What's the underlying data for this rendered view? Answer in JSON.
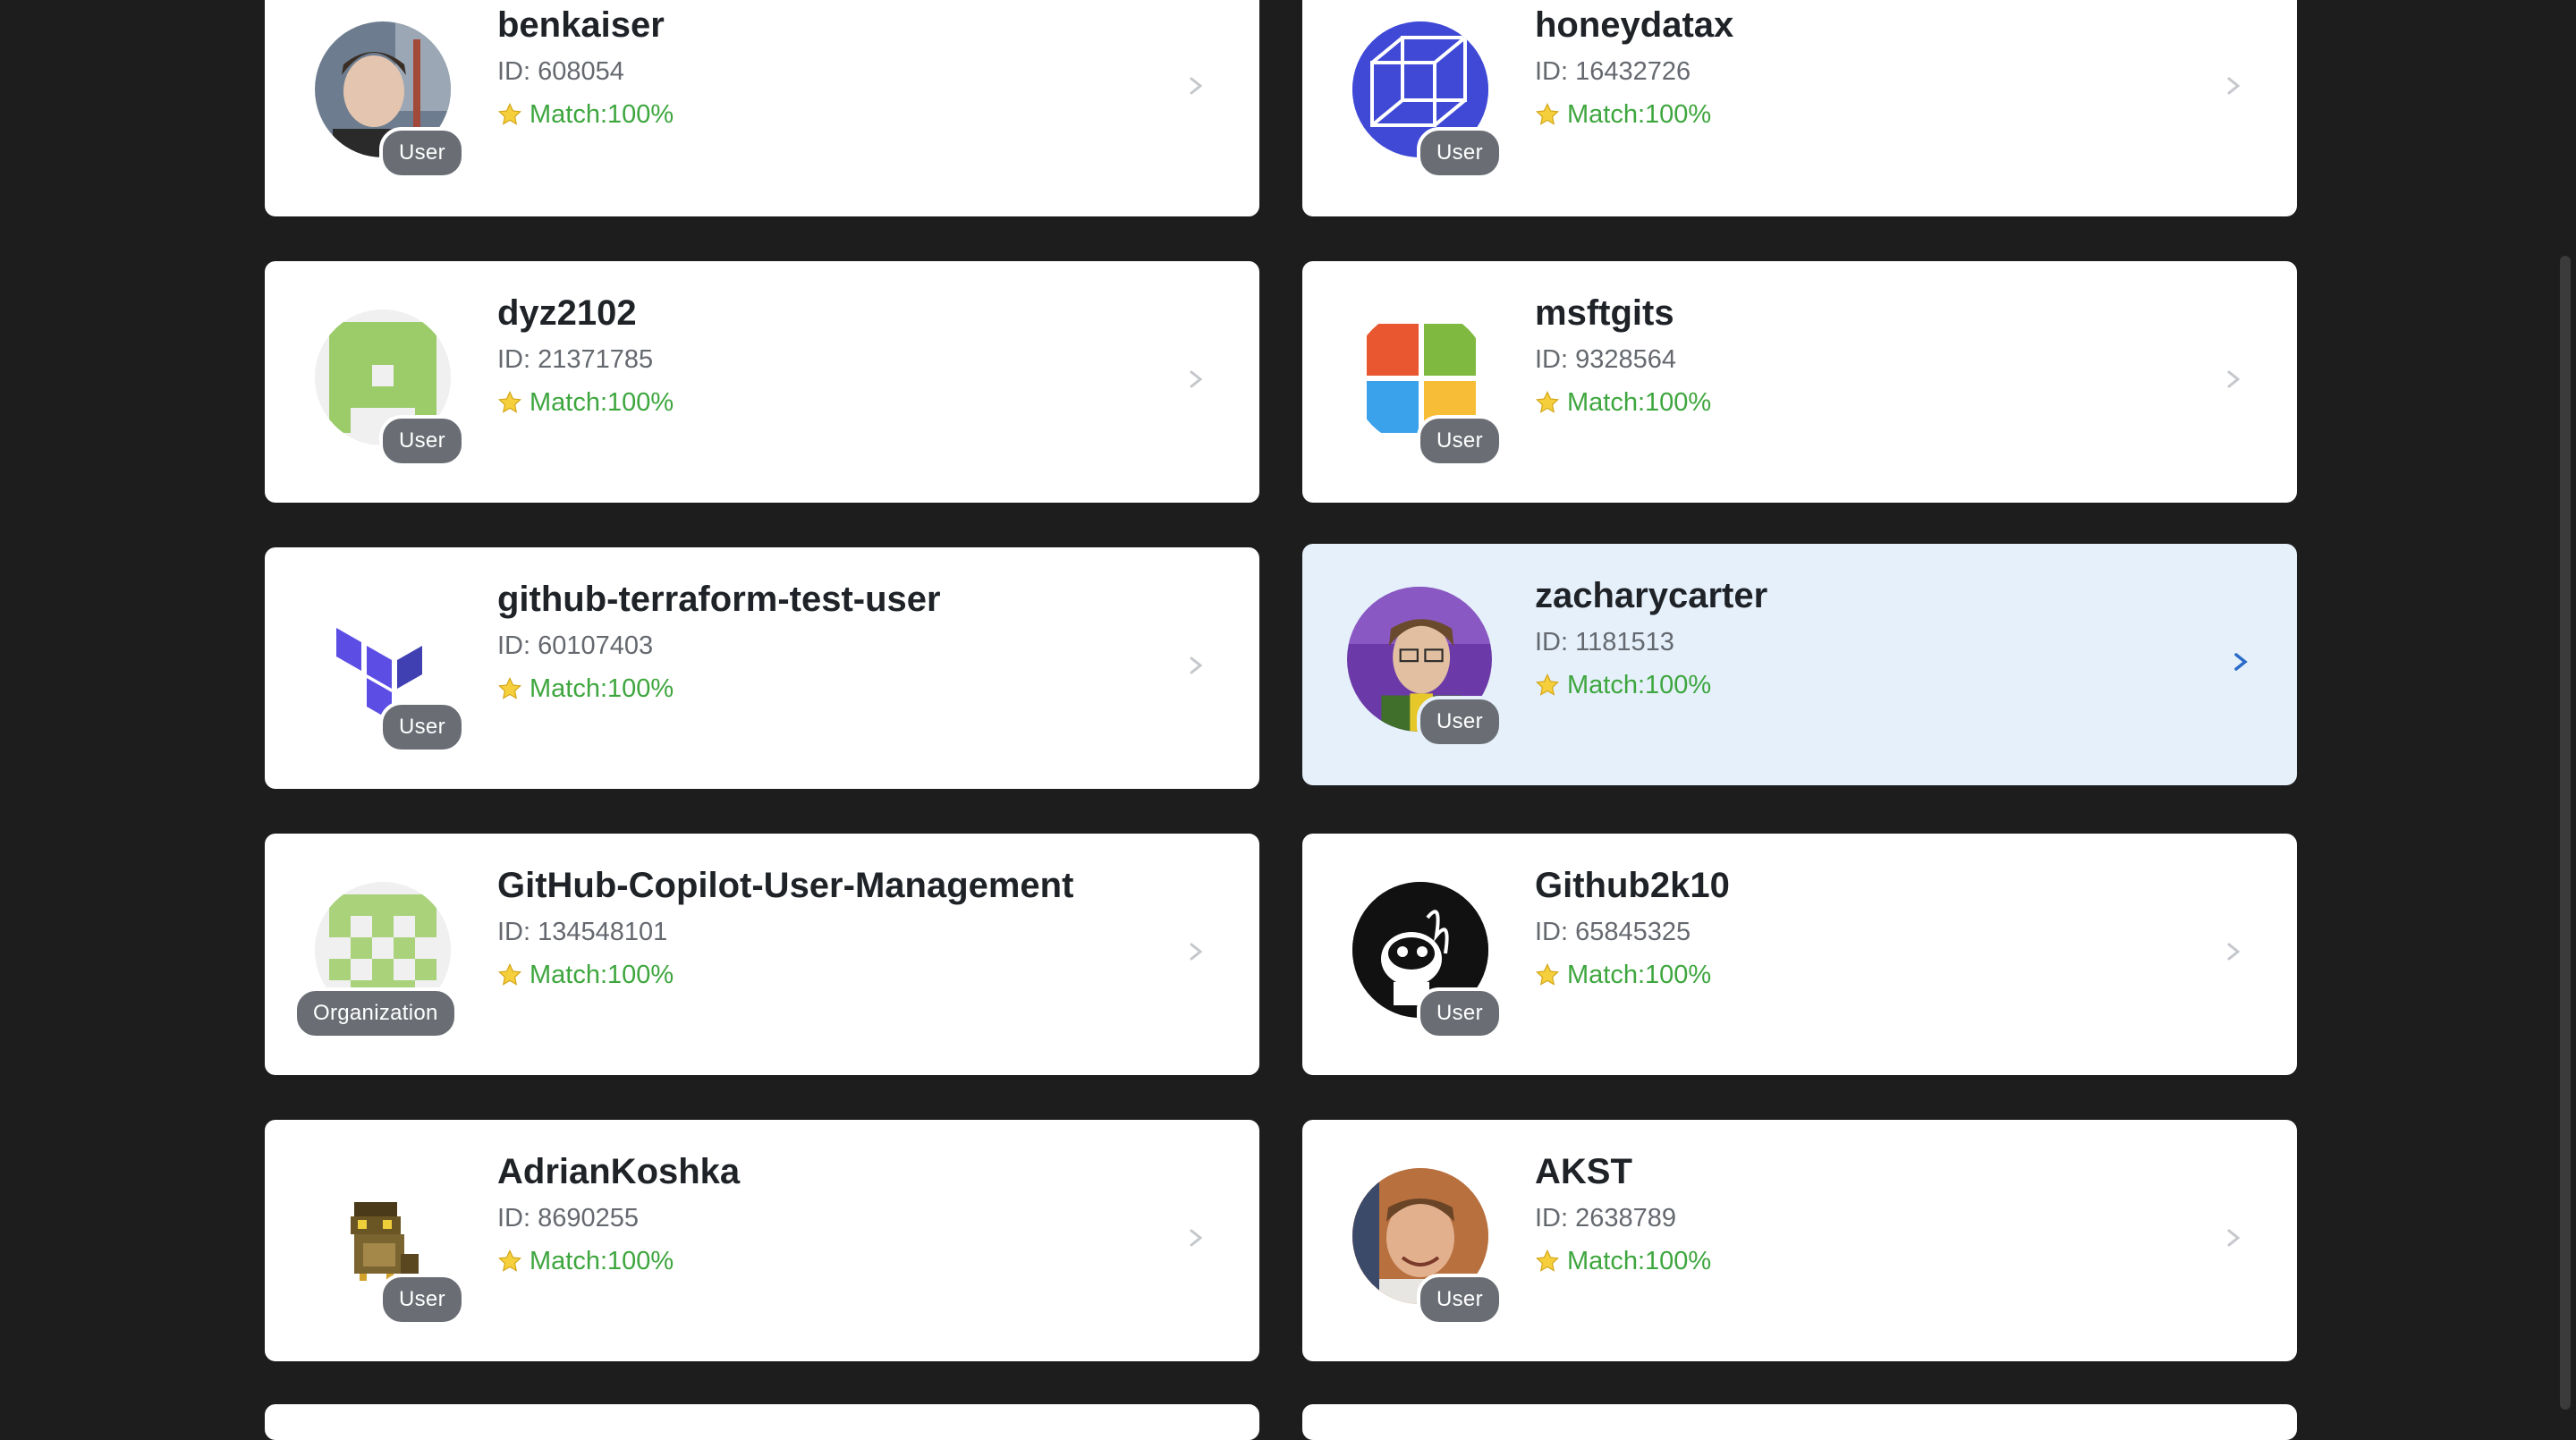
{
  "colors": {
    "background": "#1d1d1d",
    "card": "#ffffff",
    "selected": "#e5f0fb",
    "match": "#3ea63e",
    "badge": "#6a6e74",
    "chevron_active": "#2a6cc8"
  },
  "id_prefix": "ID: ",
  "match_prefix": "Match: ",
  "results": [
    {
      "name": "benkaiser",
      "id": "608054",
      "match": "100%",
      "type": "User",
      "avatar": "photo-icon"
    },
    {
      "name": "honeydatax",
      "id": "16432726",
      "match": "100%",
      "type": "User",
      "avatar": "cube-icon"
    },
    {
      "name": "dyz2102",
      "id": "21371785",
      "match": "100%",
      "type": "User",
      "avatar": "identicon-icon"
    },
    {
      "name": "msftgits",
      "id": "9328564",
      "match": "100%",
      "type": "User",
      "avatar": "windows-logo-icon"
    },
    {
      "name": "github-terraform-test-user",
      "id": "60107403",
      "match": "100%",
      "type": "User",
      "avatar": "terraform-logo-icon"
    },
    {
      "name": "zacharycarter",
      "id": "1181513",
      "match": "100%",
      "type": "User",
      "avatar": "photo-icon",
      "selected": true
    },
    {
      "name": "GitHub-Copilot-User-Management",
      "id": "134548101",
      "match": "100%",
      "type": "Organization",
      "avatar": "identicon-icon"
    },
    {
      "name": "Github2k10",
      "id": "65845325",
      "match": "100%",
      "type": "User",
      "avatar": "cartoon-icon"
    },
    {
      "name": "AdrianKoshka",
      "id": "8690255",
      "match": "100%",
      "type": "User",
      "avatar": "owl-icon"
    },
    {
      "name": "AKST",
      "id": "2638789",
      "match": "100%",
      "type": "User",
      "avatar": "photo-icon"
    }
  ]
}
